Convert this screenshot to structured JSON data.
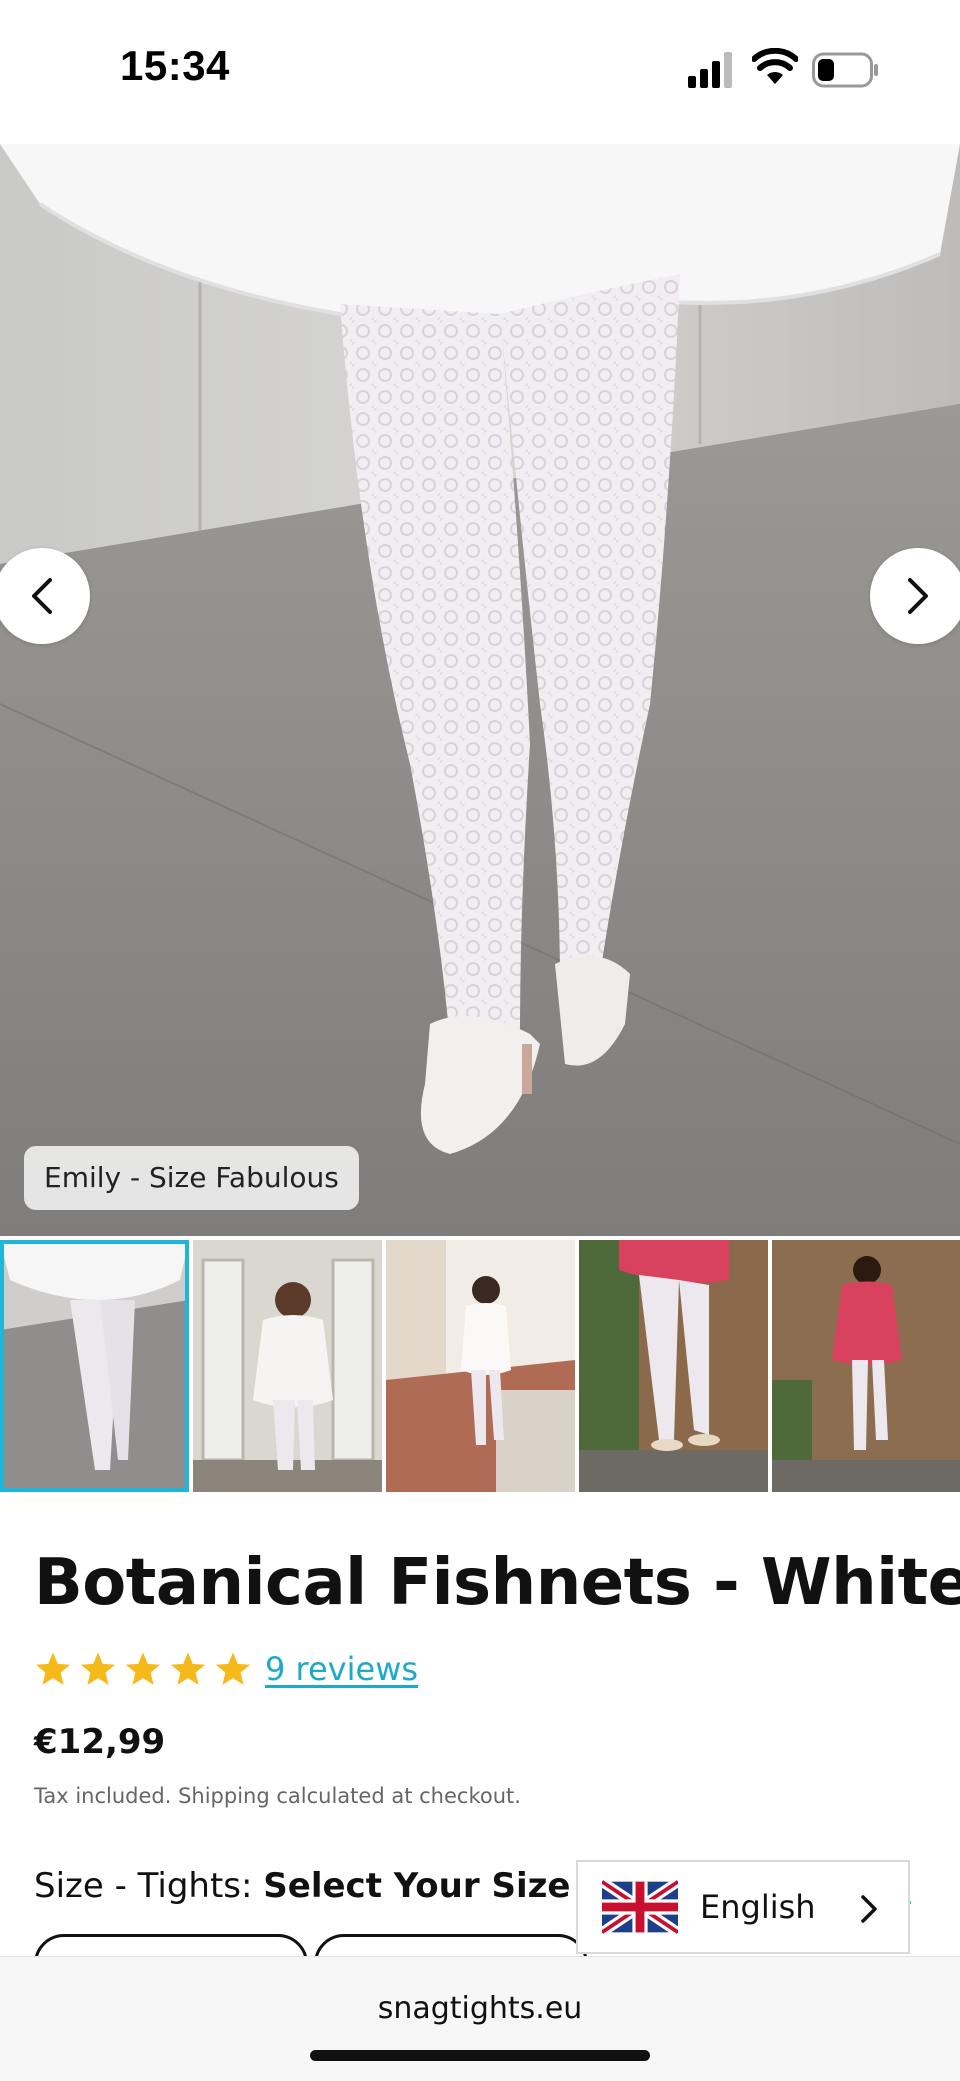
{
  "status_bar": {
    "time": "15:34"
  },
  "gallery": {
    "caption": "Emily - Size Fabulous",
    "prev_label": "previous-image",
    "next_label": "next-image",
    "active_index": 0,
    "thumbnail_count": 5
  },
  "product": {
    "title": "Botanical Fishnets - White",
    "rating_stars": 5,
    "reviews_link": "9 reviews",
    "price": "€12,99",
    "tax_note": "Tax included. Shipping calculated at checkout.",
    "size_prefix": "Size - Tights: ",
    "size_value": "Select Your Size",
    "size_chart_link_partial": "e"
  },
  "language_selector": {
    "label": "English",
    "flag": "uk-flag-icon"
  },
  "browser": {
    "url": "snagtights.eu"
  },
  "colors": {
    "accent": "#1fa9c9",
    "thumb_active_border": "#1fb6d8",
    "star": "#f6b91a"
  }
}
